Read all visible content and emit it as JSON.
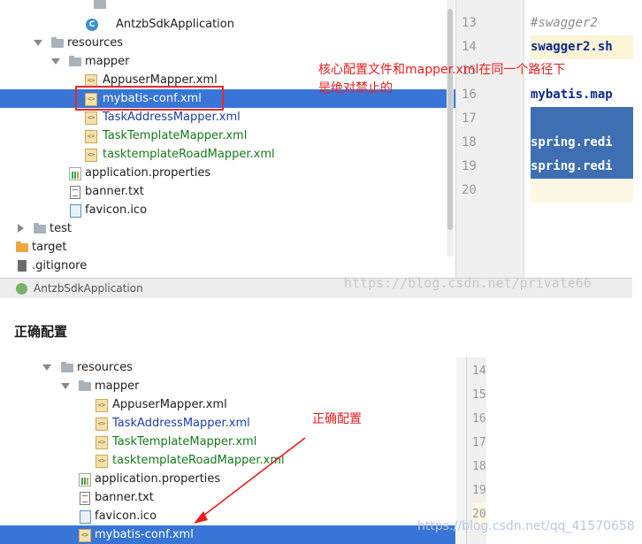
{
  "top": {
    "tree": {
      "rows": [
        {
          "label": "AntzbSdkApplication",
          "icon": "class-icon"
        },
        {
          "label": "resources",
          "icon": "resources-folder-icon"
        },
        {
          "label": "mapper",
          "icon": "folder-icon"
        },
        {
          "label": "AppuserMapper.xml",
          "icon": "xml-file-icon"
        },
        {
          "label": "mybatis-conf.xml",
          "icon": "xml-file-icon",
          "selected": true
        },
        {
          "label": "TaskAddressMapper.xml",
          "icon": "xml-file-icon"
        },
        {
          "label": "TaskTemplateMapper.xml",
          "icon": "xml-file-icon"
        },
        {
          "label": "tasktemplateRoadMapper.xml",
          "icon": "xml-file-icon"
        },
        {
          "label": "application.properties",
          "icon": "properties-file-icon"
        },
        {
          "label": "banner.txt",
          "icon": "text-file-icon"
        },
        {
          "label": "favicon.ico",
          "icon": "ico-file-icon"
        },
        {
          "label": "test",
          "icon": "folder-icon"
        },
        {
          "label": "target",
          "icon": "excluded-folder-icon"
        },
        {
          "label": ".gitignore",
          "icon": "gitignore-file-icon"
        }
      ]
    },
    "editor": {
      "line_numbers": [
        "13",
        "14",
        "15",
        "16",
        "17",
        "18",
        "19",
        "20"
      ],
      "lines": [
        {
          "text": "#swagger2"
        },
        {
          "text": "swagger2.sh"
        },
        {
          "text": ""
        },
        {
          "text": "mybatis.map"
        },
        {
          "text": ""
        },
        {
          "text": "spring.redi"
        },
        {
          "text": "spring.redi"
        },
        {
          "text": ""
        }
      ]
    },
    "status_bar": {
      "run_config": "AntzbSdkApplication"
    },
    "annotation_line1": "核心配置文件和mapper.xml在同一个路径下",
    "annotation_line2": "是绝对禁止的",
    "watermark": "https://blog.csdn.net/private66"
  },
  "section_title": "正确配置",
  "bottom": {
    "tree": {
      "rows": [
        {
          "label": "resources",
          "icon": "resources-folder-icon"
        },
        {
          "label": "mapper",
          "icon": "folder-icon"
        },
        {
          "label": "AppuserMapper.xml",
          "icon": "xml-file-icon"
        },
        {
          "label": "TaskAddressMapper.xml",
          "icon": "xml-file-icon"
        },
        {
          "label": "TaskTemplateMapper.xml",
          "icon": "xml-file-icon"
        },
        {
          "label": "tasktemplateRoadMapper.xml",
          "icon": "xml-file-icon"
        },
        {
          "label": "application.properties",
          "icon": "properties-file-icon"
        },
        {
          "label": "banner.txt",
          "icon": "text-file-icon"
        },
        {
          "label": "favicon.ico",
          "icon": "ico-file-icon"
        },
        {
          "label": "mybatis-conf.xml",
          "icon": "xml-file-icon",
          "selected": true
        }
      ]
    },
    "line_numbers": [
      "14",
      "15",
      "16",
      "17",
      "18",
      "19",
      "20"
    ],
    "annotation": "正确配置",
    "watermark": "https://blog.csdn.net/qq_41570658"
  },
  "colors": {
    "selection": "#3875d7",
    "annotation_red": "#ee1c1c",
    "vcs_added_green": "#16791b",
    "vcs_modified_blue": "#1c3fa6"
  }
}
